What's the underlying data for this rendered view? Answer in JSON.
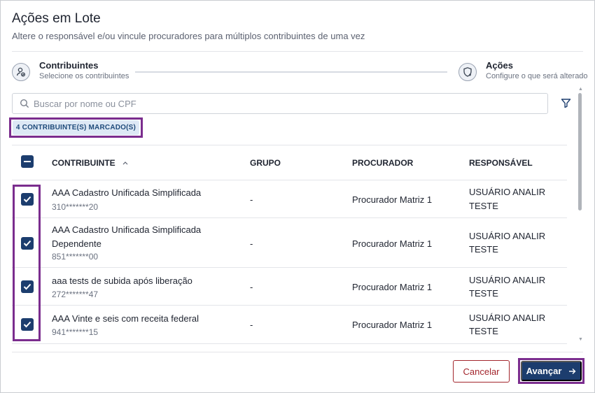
{
  "dialog": {
    "title": "Ações em Lote",
    "subtitle": "Altere o responsável e/ou vincule procuradores para múltiplos contribuintes de uma vez"
  },
  "stepper": {
    "steps": [
      {
        "title": "Contribuintes",
        "subtitle": "Selecione os contribuintes",
        "icon": "user-group-icon"
      },
      {
        "title": "Ações",
        "subtitle": "Configure o que será alterado",
        "icon": "shield-add-icon"
      }
    ]
  },
  "search": {
    "placeholder": "Buscar por nome ou CPF",
    "value": ""
  },
  "badge": {
    "label": "4 CONTRIBUINTE(S) MARCADO(S)"
  },
  "table": {
    "columns": {
      "contribuinte": "CONTRIBUINTE",
      "grupo": "GRUPO",
      "procurador": "PROCURADOR",
      "responsavel": "RESPONSÁVEL"
    },
    "sort_indicator": "^",
    "rows": [
      {
        "name_line1": "AAA Cadastro Unificada Simplificada",
        "name_line2": "",
        "cpf": "310*******20",
        "grupo": "-",
        "procurador": "Procurador Matriz 1",
        "responsavel_line1": "USUÁRIO ANALIR",
        "responsavel_line2": "TESTE",
        "checked": true
      },
      {
        "name_line1": "AAA Cadastro Unificada Simplificada",
        "name_line2": "Dependente",
        "cpf": "851*******00",
        "grupo": "-",
        "procurador": "Procurador Matriz 1",
        "responsavel_line1": "USUÁRIO ANALIR",
        "responsavel_line2": "TESTE",
        "checked": true
      },
      {
        "name_line1": "aaa tests de subida após liberação",
        "name_line2": "",
        "cpf": "272*******47",
        "grupo": "-",
        "procurador": "Procurador Matriz 1",
        "responsavel_line1": "USUÁRIO ANALIR",
        "responsavel_line2": "TESTE",
        "checked": true
      },
      {
        "name_line1": "AAA Vinte e seis com receita federal",
        "name_line2": "",
        "cpf": "941*******15",
        "grupo": "-",
        "procurador": "Procurador Matriz 1",
        "responsavel_line1": "USUÁRIO ANALIR",
        "responsavel_line2": "TESTE",
        "checked": true
      }
    ]
  },
  "footer": {
    "cancel_label": "Cancelar",
    "next_label": "Avançar",
    "next_icon": "arrow-right-icon"
  },
  "colors": {
    "primary": "#1c3d6e",
    "danger": "#a3262d",
    "highlight": "#7b2d8e",
    "badge_bg": "#dde8f5"
  }
}
